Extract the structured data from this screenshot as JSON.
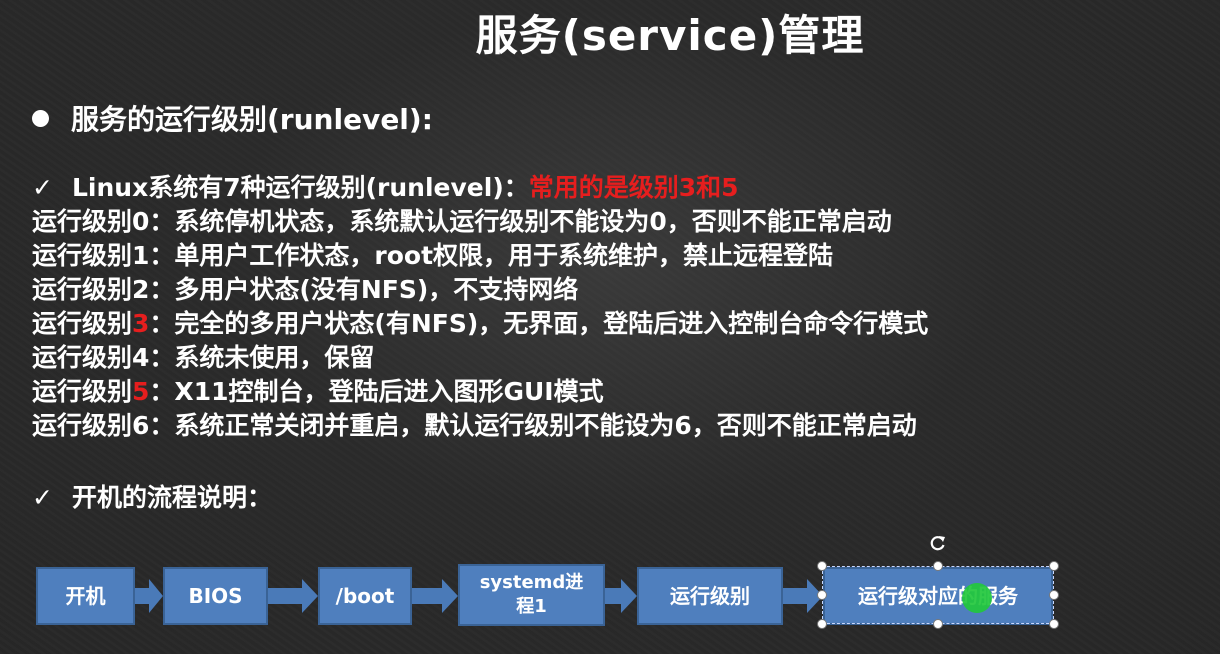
{
  "slide": {
    "title": "服务(service)管理",
    "bullet": "服务的运行级别(runlevel):",
    "line1": {
      "check": "✓",
      "text": "Linux系统有7种运行级别(runlevel)：",
      "highlight": "常用的是级别3和5"
    },
    "levels": {
      "l0": "运行级别0：系统停机状态，系统默认运行级别不能设为0，否则不能正常启动",
      "l1": "运行级别1：单用户工作状态，root权限，用于系统维护，禁止远程登陆",
      "l2": "运行级别2：多用户状态(没有NFS)，不支持网络",
      "l3_prefix": "运行级别",
      "l3_num": "3",
      "l3_rest": "：完全的多用户状态(有NFS)，无界面，登陆后进入控制台命令行模式",
      "l4": "运行级别4：系统未使用，保留",
      "l5_prefix": "运行级别",
      "l5_num": "5",
      "l5_rest": "：X11控制台，登陆后进入图形GUI模式",
      "l6": "运行级别6：系统正常关闭并重启，默认运行级别不能设为6，否则不能正常启动"
    },
    "flow_heading": {
      "check": "✓",
      "text": "开机的流程说明："
    },
    "flow": {
      "boot_on": "开机",
      "bios": "BIOS",
      "boot": "/boot",
      "systemd_line1": "systemd进",
      "systemd_line2": "程1",
      "runlevel": "运行级别",
      "services": "运行级对应的服务"
    }
  },
  "colors": {
    "background": "#2c2c2c",
    "text": "#ffffff",
    "highlight_red": "#e61e1e",
    "box_fill": "#4f7fbe",
    "box_border": "#3a6396",
    "arrow_fill": "#4a7ab8",
    "cursor_green": "#22c83c"
  },
  "icons": {
    "bullet": "filled-circle",
    "check": "checkmark",
    "arrow": "right-arrow-icon",
    "rotate": "rotate-handle-icon"
  }
}
